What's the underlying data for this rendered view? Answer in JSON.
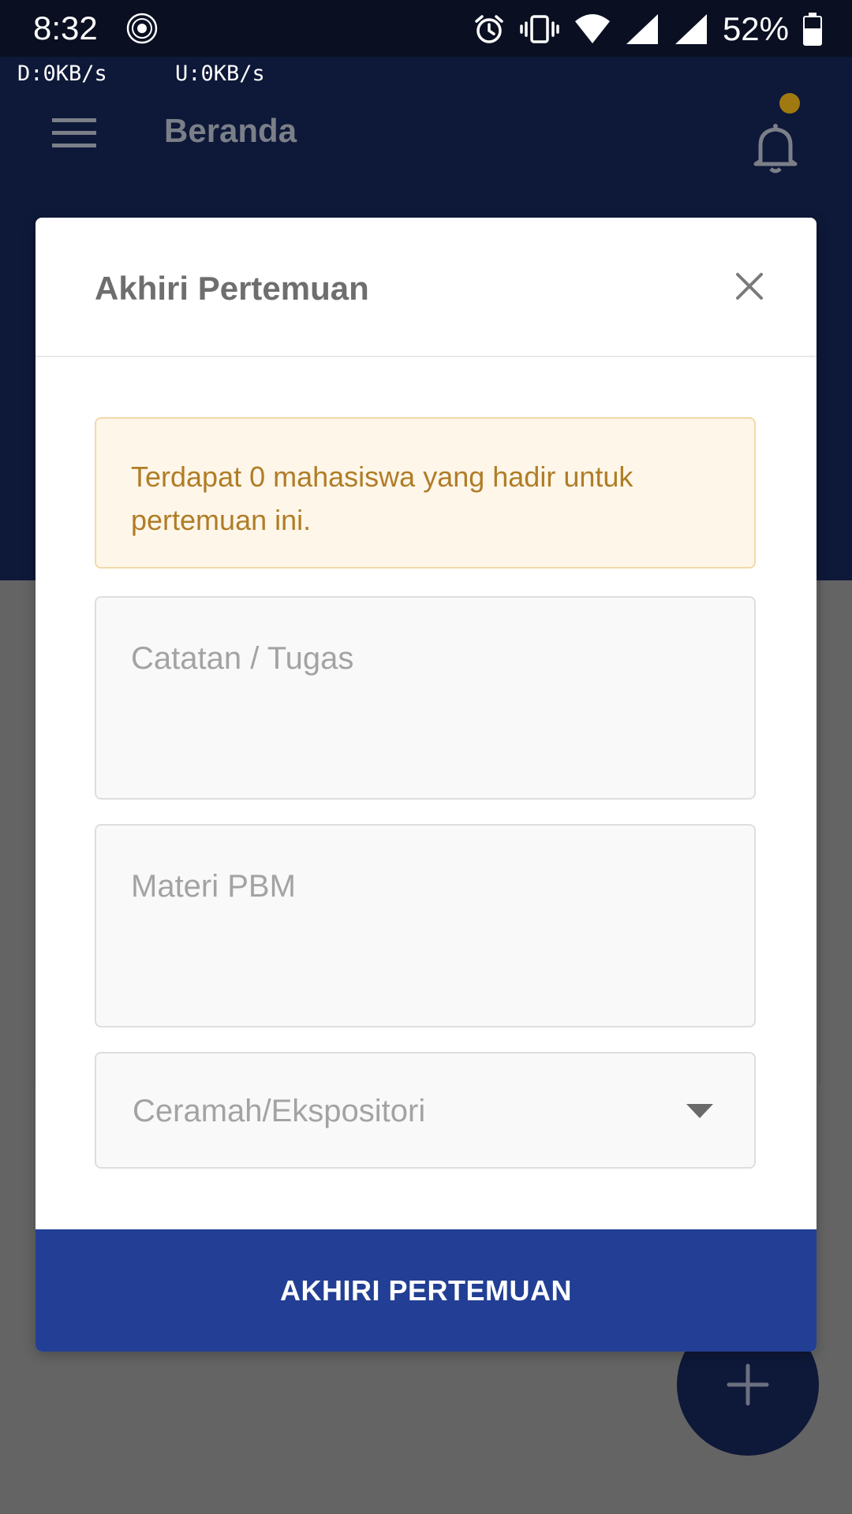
{
  "status_bar": {
    "time": "8:32",
    "battery_percent": "52%",
    "icons": [
      "app-seal-icon",
      "alarm-icon",
      "vibrate-icon",
      "wifi-icon",
      "signal-icon",
      "signal-icon",
      "battery-icon"
    ]
  },
  "network": {
    "download": "D:0KB/s",
    "upload": "U:0KB/s"
  },
  "app_bar": {
    "title": "Beranda",
    "menu_icon": "hamburger-menu-icon",
    "notification_icon": "bell-icon",
    "notification_dot_color": "#a07a10"
  },
  "modal": {
    "title": "Akhiri Pertemuan",
    "alert_text": "Terdapat 0 mahasiswa yang hadir untuk pertemuan ini.",
    "notes_field": {
      "placeholder": "Catatan / Tugas",
      "value": ""
    },
    "materi_field": {
      "placeholder": "Materi PBM",
      "value": ""
    },
    "method_select": {
      "selected": "Ceramah/Ekspositori"
    },
    "submit_label": "AKHIRI PERTEMUAN"
  },
  "fab": {
    "icon": "plus-icon"
  },
  "colors": {
    "primary_dark": "#0e1838",
    "button_blue": "#223f95",
    "alert_text": "#b07d26",
    "alert_bg": "#fef6e9",
    "alert_border": "#f2d9a7",
    "overlay_gray": "#646464"
  }
}
